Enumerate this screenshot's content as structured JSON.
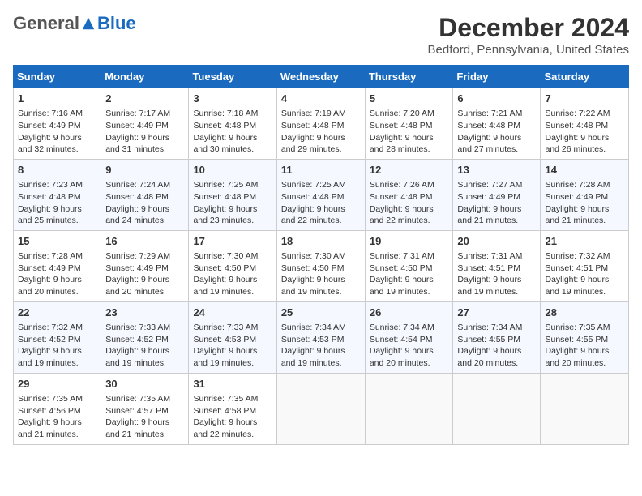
{
  "header": {
    "logo_general": "General",
    "logo_blue": "Blue",
    "month_title": "December 2024",
    "location": "Bedford, Pennsylvania, United States"
  },
  "days_of_week": [
    "Sunday",
    "Monday",
    "Tuesday",
    "Wednesday",
    "Thursday",
    "Friday",
    "Saturday"
  ],
  "weeks": [
    [
      {
        "day": "1",
        "info": "Sunrise: 7:16 AM\nSunset: 4:49 PM\nDaylight: 9 hours and 32 minutes."
      },
      {
        "day": "2",
        "info": "Sunrise: 7:17 AM\nSunset: 4:49 PM\nDaylight: 9 hours and 31 minutes."
      },
      {
        "day": "3",
        "info": "Sunrise: 7:18 AM\nSunset: 4:48 PM\nDaylight: 9 hours and 30 minutes."
      },
      {
        "day": "4",
        "info": "Sunrise: 7:19 AM\nSunset: 4:48 PM\nDaylight: 9 hours and 29 minutes."
      },
      {
        "day": "5",
        "info": "Sunrise: 7:20 AM\nSunset: 4:48 PM\nDaylight: 9 hours and 28 minutes."
      },
      {
        "day": "6",
        "info": "Sunrise: 7:21 AM\nSunset: 4:48 PM\nDaylight: 9 hours and 27 minutes."
      },
      {
        "day": "7",
        "info": "Sunrise: 7:22 AM\nSunset: 4:48 PM\nDaylight: 9 hours and 26 minutes."
      }
    ],
    [
      {
        "day": "8",
        "info": "Sunrise: 7:23 AM\nSunset: 4:48 PM\nDaylight: 9 hours and 25 minutes."
      },
      {
        "day": "9",
        "info": "Sunrise: 7:24 AM\nSunset: 4:48 PM\nDaylight: 9 hours and 24 minutes."
      },
      {
        "day": "10",
        "info": "Sunrise: 7:25 AM\nSunset: 4:48 PM\nDaylight: 9 hours and 23 minutes."
      },
      {
        "day": "11",
        "info": "Sunrise: 7:25 AM\nSunset: 4:48 PM\nDaylight: 9 hours and 22 minutes."
      },
      {
        "day": "12",
        "info": "Sunrise: 7:26 AM\nSunset: 4:48 PM\nDaylight: 9 hours and 22 minutes."
      },
      {
        "day": "13",
        "info": "Sunrise: 7:27 AM\nSunset: 4:49 PM\nDaylight: 9 hours and 21 minutes."
      },
      {
        "day": "14",
        "info": "Sunrise: 7:28 AM\nSunset: 4:49 PM\nDaylight: 9 hours and 21 minutes."
      }
    ],
    [
      {
        "day": "15",
        "info": "Sunrise: 7:28 AM\nSunset: 4:49 PM\nDaylight: 9 hours and 20 minutes."
      },
      {
        "day": "16",
        "info": "Sunrise: 7:29 AM\nSunset: 4:49 PM\nDaylight: 9 hours and 20 minutes."
      },
      {
        "day": "17",
        "info": "Sunrise: 7:30 AM\nSunset: 4:50 PM\nDaylight: 9 hours and 19 minutes."
      },
      {
        "day": "18",
        "info": "Sunrise: 7:30 AM\nSunset: 4:50 PM\nDaylight: 9 hours and 19 minutes."
      },
      {
        "day": "19",
        "info": "Sunrise: 7:31 AM\nSunset: 4:50 PM\nDaylight: 9 hours and 19 minutes."
      },
      {
        "day": "20",
        "info": "Sunrise: 7:31 AM\nSunset: 4:51 PM\nDaylight: 9 hours and 19 minutes."
      },
      {
        "day": "21",
        "info": "Sunrise: 7:32 AM\nSunset: 4:51 PM\nDaylight: 9 hours and 19 minutes."
      }
    ],
    [
      {
        "day": "22",
        "info": "Sunrise: 7:32 AM\nSunset: 4:52 PM\nDaylight: 9 hours and 19 minutes."
      },
      {
        "day": "23",
        "info": "Sunrise: 7:33 AM\nSunset: 4:52 PM\nDaylight: 9 hours and 19 minutes."
      },
      {
        "day": "24",
        "info": "Sunrise: 7:33 AM\nSunset: 4:53 PM\nDaylight: 9 hours and 19 minutes."
      },
      {
        "day": "25",
        "info": "Sunrise: 7:34 AM\nSunset: 4:53 PM\nDaylight: 9 hours and 19 minutes."
      },
      {
        "day": "26",
        "info": "Sunrise: 7:34 AM\nSunset: 4:54 PM\nDaylight: 9 hours and 20 minutes."
      },
      {
        "day": "27",
        "info": "Sunrise: 7:34 AM\nSunset: 4:55 PM\nDaylight: 9 hours and 20 minutes."
      },
      {
        "day": "28",
        "info": "Sunrise: 7:35 AM\nSunset: 4:55 PM\nDaylight: 9 hours and 20 minutes."
      }
    ],
    [
      {
        "day": "29",
        "info": "Sunrise: 7:35 AM\nSunset: 4:56 PM\nDaylight: 9 hours and 21 minutes."
      },
      {
        "day": "30",
        "info": "Sunrise: 7:35 AM\nSunset: 4:57 PM\nDaylight: 9 hours and 21 minutes."
      },
      {
        "day": "31",
        "info": "Sunrise: 7:35 AM\nSunset: 4:58 PM\nDaylight: 9 hours and 22 minutes."
      },
      null,
      null,
      null,
      null
    ]
  ]
}
